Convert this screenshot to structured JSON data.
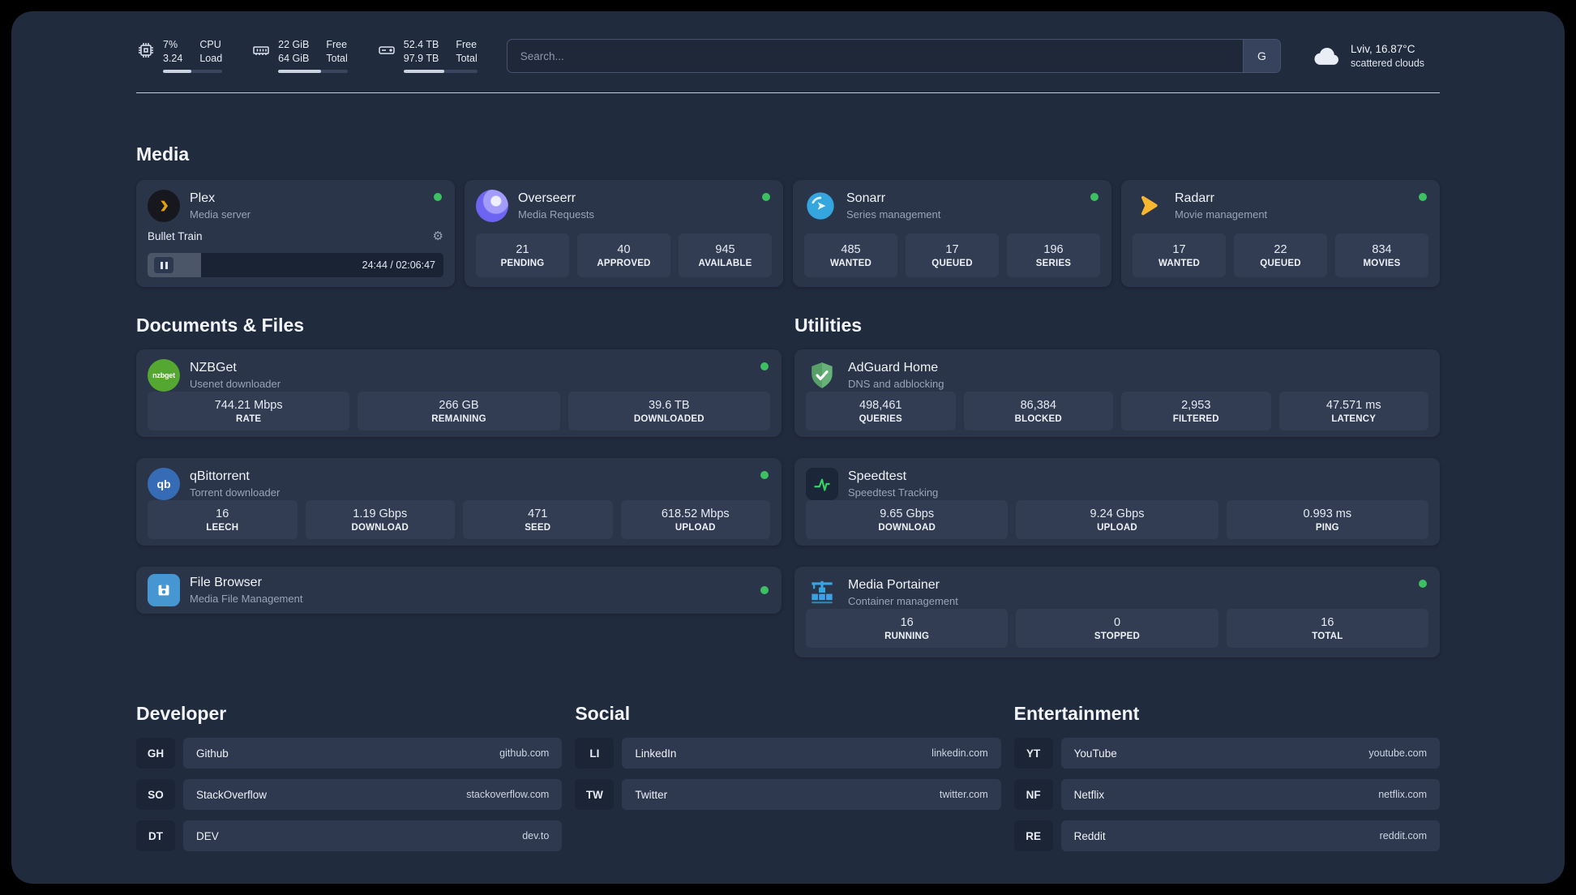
{
  "colors": {
    "background": "#212b3e",
    "card": "#2a3549",
    "tile": "#323d53",
    "status_green": "#3cc061",
    "plex_gold": "#e5a00d",
    "sonarr_blue": "#35a6dd",
    "radarr_yellow": "#f8b62e",
    "adguard_green": "#67b279",
    "portainer_blue": "#3aa3e3"
  },
  "icons": {
    "settings": "⚙"
  },
  "topbar": {
    "cpu": {
      "value1": "7%",
      "value2": "3.24",
      "label1": "CPU",
      "label2": "Load"
    },
    "ram": {
      "value1": "22 GiB",
      "value2": "64 GiB",
      "label1": "Free",
      "label2": "Total"
    },
    "disk": {
      "value1": "52.4 TB",
      "value2": "97.9 TB",
      "label1": "Free",
      "label2": "Total"
    },
    "search": {
      "placeholder": "Search...",
      "engine": "G"
    },
    "weather": {
      "location": "Lviv, 16.87°C",
      "condition": "scattered clouds"
    }
  },
  "sections": {
    "media": "Media",
    "documents": "Documents & Files",
    "utilities": "Utilities",
    "developer": "Developer",
    "social": "Social",
    "entertainment": "Entertainment"
  },
  "apps": {
    "plex": {
      "title": "Plex",
      "subtitle": "Media server",
      "now_playing": "Bullet Train",
      "time": "24:44 / 02:06:47"
    },
    "overseerr": {
      "title": "Overseerr",
      "subtitle": "Media Requests",
      "stats": [
        {
          "value": "21",
          "label": "PENDING"
        },
        {
          "value": "40",
          "label": "APPROVED"
        },
        {
          "value": "945",
          "label": "AVAILABLE"
        }
      ]
    },
    "sonarr": {
      "title": "Sonarr",
      "subtitle": "Series management",
      "stats": [
        {
          "value": "485",
          "label": "WANTED"
        },
        {
          "value": "17",
          "label": "QUEUED"
        },
        {
          "value": "196",
          "label": "SERIES"
        }
      ]
    },
    "radarr": {
      "title": "Radarr",
      "subtitle": "Movie management",
      "stats": [
        {
          "value": "17",
          "label": "WANTED"
        },
        {
          "value": "22",
          "label": "QUEUED"
        },
        {
          "value": "834",
          "label": "MOVIES"
        }
      ]
    },
    "nzbget": {
      "title": "NZBGet",
      "subtitle": "Usenet downloader",
      "icon_text": "nzbget",
      "stats": [
        {
          "value": "744.21 Mbps",
          "label": "RATE"
        },
        {
          "value": "266 GB",
          "label": "REMAINING"
        },
        {
          "value": "39.6 TB",
          "label": "DOWNLOADED"
        }
      ]
    },
    "qbittorrent": {
      "title": "qBittorrent",
      "subtitle": "Torrent downloader",
      "icon_text": "qb",
      "stats": [
        {
          "value": "16",
          "label": "LEECH"
        },
        {
          "value": "1.19 Gbps",
          "label": "DOWNLOAD"
        },
        {
          "value": "471",
          "label": "SEED"
        },
        {
          "value": "618.52 Mbps",
          "label": "UPLOAD"
        }
      ]
    },
    "filebrowser": {
      "title": "File Browser",
      "subtitle": "Media File Management"
    },
    "adguard": {
      "title": "AdGuard Home",
      "subtitle": "DNS and adblocking",
      "stats": [
        {
          "value": "498,461",
          "label": "QUERIES"
        },
        {
          "value": "86,384",
          "label": "BLOCKED"
        },
        {
          "value": "2,953",
          "label": "FILTERED"
        },
        {
          "value": "47.571 ms",
          "label": "LATENCY"
        }
      ]
    },
    "speedtest": {
      "title": "Speedtest",
      "subtitle": "Speedtest Tracking",
      "stats": [
        {
          "value": "9.65 Gbps",
          "label": "DOWNLOAD"
        },
        {
          "value": "9.24 Gbps",
          "label": "UPLOAD"
        },
        {
          "value": "0.993 ms",
          "label": "PING"
        }
      ]
    },
    "portainer": {
      "title": "Media Portainer",
      "subtitle": "Container management",
      "stats": [
        {
          "value": "16",
          "label": "RUNNING"
        },
        {
          "value": "0",
          "label": "STOPPED"
        },
        {
          "value": "16",
          "label": "TOTAL"
        }
      ]
    }
  },
  "bookmarks": {
    "developer": [
      {
        "abbr": "GH",
        "name": "Github",
        "url": "github.com"
      },
      {
        "abbr": "SO",
        "name": "StackOverflow",
        "url": "stackoverflow.com"
      },
      {
        "abbr": "DT",
        "name": "DEV",
        "url": "dev.to"
      }
    ],
    "social": [
      {
        "abbr": "LI",
        "name": "LinkedIn",
        "url": "linkedin.com"
      },
      {
        "abbr": "TW",
        "name": "Twitter",
        "url": "twitter.com"
      }
    ],
    "entertainment": [
      {
        "abbr": "YT",
        "name": "YouTube",
        "url": "youtube.com"
      },
      {
        "abbr": "NF",
        "name": "Netflix",
        "url": "netflix.com"
      },
      {
        "abbr": "RE",
        "name": "Reddit",
        "url": "reddit.com"
      }
    ]
  }
}
